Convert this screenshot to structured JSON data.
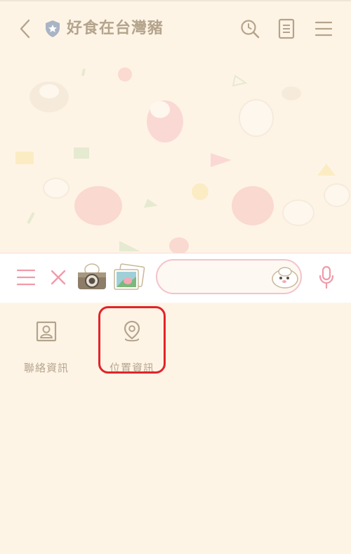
{
  "header": {
    "title": "好食在台灣豬",
    "back_icon": "chevron-left-icon",
    "badge_icon": "shield-star-icon",
    "search_icon": "clock-search-icon",
    "notes_icon": "note-icon",
    "menu_icon": "hamburger-icon"
  },
  "toolbar": {
    "menu_icon": "hamburger-icon",
    "close_icon": "close-icon",
    "camera_icon": "camera-icon",
    "photo_icon": "photo-album-icon",
    "input_value": "",
    "input_placeholder": "",
    "sticker_icon": "sticker-icon",
    "mic_icon": "microphone-icon"
  },
  "options": [
    {
      "label": "聯絡資訊",
      "icon": "contact-card-icon"
    },
    {
      "label": "位置資訊",
      "icon": "location-pin-icon",
      "highlighted": true
    }
  ],
  "colors": {
    "background": "#FEF4E6",
    "header_text": "#B4A48C",
    "toolbar_accent": "#F29AA8",
    "highlight": "#E2232A"
  }
}
